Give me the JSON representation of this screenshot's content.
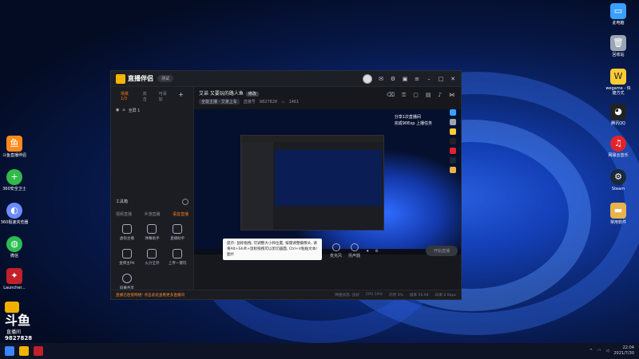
{
  "desktop": {
    "icons_right": [
      {
        "label": "此电脑",
        "color": "#3aa0ff"
      },
      {
        "label": "回收站",
        "color": "#9aa4b2"
      },
      {
        "label": "wegame - 快捷方式",
        "color": "#ffcc33"
      },
      {
        "label": "腾讯QQ",
        "color": "#222222"
      },
      {
        "label": "网易云音乐",
        "color": "#e2242a"
      },
      {
        "label": "Steam",
        "color": "#1b2838"
      },
      {
        "label": "常用软件",
        "color": "#e8b34a"
      }
    ],
    "icons_left": [
      {
        "label": "斗鱼直播伴侣",
        "color": "#ff8a1c"
      },
      {
        "label": "360安全卫士",
        "color": "#32b84b"
      },
      {
        "label": "360极速浏览器",
        "color": "#6c8cff"
      },
      {
        "label": "微信",
        "color": "#2bbd52"
      },
      {
        "label": "Launcher...",
        "color": "#c2202a"
      }
    ]
  },
  "app": {
    "name": "直播伴侣",
    "version_badge": "测试",
    "left_tabs": [
      "场景1/3",
      "双击",
      "可添加"
    ],
    "scene_item": "全屏 1",
    "tools_title": "工具箱",
    "tool_tabs": [
      "视频直播",
      "手游直播",
      "语音直播"
    ],
    "tools": [
      "虚拟主播",
      "弹幕助手",
      "直播助手",
      "金牌主PK",
      "火力全开",
      "上传一键玩",
      "屏幕共享"
    ],
    "room_title": "艾弟 又要玩的路人鱼",
    "room_tag": "修改",
    "room_category": "全能主播 · 艾弟上车",
    "room_id_label": "直播号",
    "room_id": "9827828",
    "fans": "1461",
    "overlay_lines": [
      "分享1次直播间",
      "完成90Exp 上播任务"
    ],
    "tooltip": "提示: 鼠标拖拽, 可调整大小和位置, 按键调整摄像头, 请将Alt+Shift+鼠标拖拽可以剪切画面, Ctrl+V粘贴文本/图片",
    "controls": [
      "麦克风",
      "扬声器"
    ],
    "start_button": "开始直播",
    "status_text": "直播已连接网络! 点击此处查看更多直播间",
    "stats": [
      "网络状态: 良好",
      "CPU 19%",
      "内存 5%",
      "帧率 59.94",
      "码率 0 Kbps"
    ]
  },
  "watermark": {
    "brand": "斗鱼",
    "sub": "直播间",
    "number": "9827828"
  },
  "taskbar": {
    "time": "22:04",
    "date": "2021/7/30"
  }
}
